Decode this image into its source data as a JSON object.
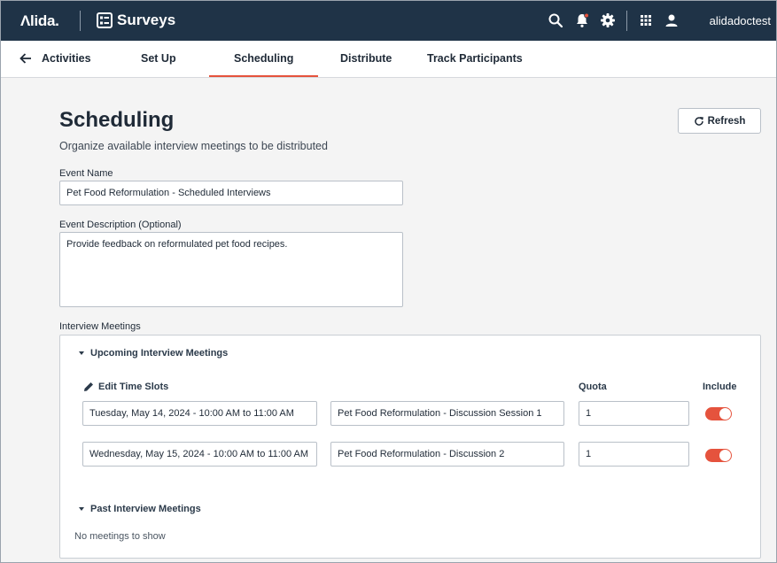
{
  "topbar": {
    "logo": "Λlida.",
    "app_title": "Surveys",
    "user": "alidadoctest",
    "icons": [
      "search-icon",
      "notification-bell-icon",
      "gear-icon",
      "apps-grid-icon",
      "user-icon"
    ]
  },
  "tabs": [
    {
      "label": "Activities"
    },
    {
      "label": "Set Up"
    },
    {
      "label": "Scheduling",
      "active": true
    },
    {
      "label": "Distribute"
    },
    {
      "label": "Track Participants"
    }
  ],
  "page": {
    "title": "Scheduling",
    "subtitle": "Organize available interview meetings to be distributed",
    "refresh_label": "Refresh"
  },
  "form": {
    "event_name_label": "Event Name",
    "event_name_value": "Pet Food Reformulation - Scheduled Interviews",
    "event_desc_label": "Event Description (Optional)",
    "event_desc_value": "Provide feedback on reformulated pet food recipes."
  },
  "meetings": {
    "label": "Interview Meetings",
    "upcoming_title": "Upcoming Interview Meetings",
    "edit_label": "Edit Time Slots",
    "quota_header": "Quota",
    "include_header": "Include",
    "rows": [
      {
        "time": "Tuesday, May 14, 2024 - 10:00 AM to 11:00 AM",
        "name": "Pet Food Reformulation - Discussion Session 1",
        "quota": "1",
        "include": true
      },
      {
        "time": "Wednesday, May 15, 2024 - 10:00 AM to 11:00 AM",
        "name": "Pet Food Reformulation - Discussion 2",
        "quota": "1",
        "include": true
      }
    ],
    "past_title": "Past Interview Meetings",
    "past_empty": "No meetings to show"
  },
  "colors": {
    "topbar": "#1f3347",
    "accent": "#e5533d"
  }
}
